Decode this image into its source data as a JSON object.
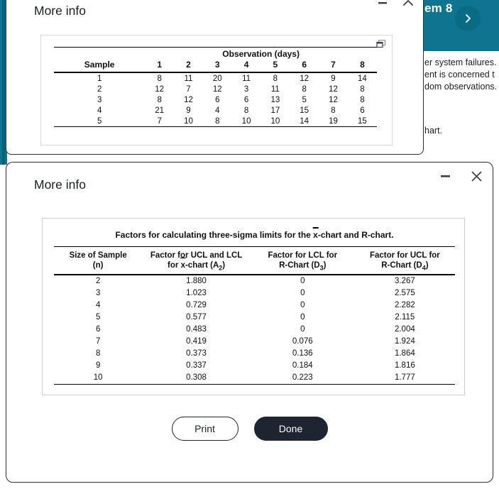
{
  "background": {
    "header": {
      "title": "em 8",
      "next_icon": "chevron-right-icon",
      "accent_color": "#0e7490",
      "button_color": "#0b6b85"
    },
    "body": {
      "line1": "er system failures.",
      "line2": "ent is concerned t",
      "line3": "dom observations.",
      "line4": "hart."
    }
  },
  "dialog_back": {
    "title": "More info",
    "window_controls": {
      "minimize": "minimize-icon",
      "maximize": "chevron-up-icon"
    },
    "popout_icon": "open-in-new-window-icon",
    "table": {
      "group_header": "Observation (days)",
      "row_header": "Sample",
      "columns": [
        "1",
        "2",
        "3",
        "4",
        "5",
        "6",
        "7",
        "8"
      ],
      "rows": [
        {
          "sample": "1",
          "values": [
            "8",
            "11",
            "20",
            "11",
            "8",
            "12",
            "9",
            "14"
          ]
        },
        {
          "sample": "2",
          "values": [
            "12",
            "7",
            "12",
            "3",
            "11",
            "8",
            "12",
            "8"
          ]
        },
        {
          "sample": "3",
          "values": [
            "8",
            "12",
            "6",
            "6",
            "13",
            "5",
            "12",
            "8"
          ]
        },
        {
          "sample": "4",
          "values": [
            "21",
            "9",
            "4",
            "8",
            "17",
            "15",
            "8",
            "6"
          ]
        },
        {
          "sample": "5",
          "values": [
            "7",
            "10",
            "8",
            "10",
            "10",
            "14",
            "19",
            "15"
          ]
        }
      ]
    }
  },
  "dialog_front": {
    "title": "More info",
    "window_controls": {
      "minimize": "minimize-icon",
      "close": "close-icon"
    },
    "table": {
      "caption_pre": "Factors for calculating three-sigma limits for the ",
      "caption_xbar": "x",
      "caption_post": "-chart and R-chart.",
      "columns": [
        {
          "line1": "Size of Sample",
          "line2": "(n)"
        },
        {
          "line1": "Factor for UCL and LCL",
          "line2_pre": "for ",
          "line2_xbar": "x",
          "line2_post": "-chart (A",
          "line2_sub": "2",
          "line2_end": ")"
        },
        {
          "line1": "Factor for LCL for",
          "line2_pre": "R-Chart (D",
          "line2_sub": "3",
          "line2_end": ")"
        },
        {
          "line1": "Factor for UCL for",
          "line2_pre": "R-Chart (D",
          "line2_sub": "4",
          "line2_end": ")"
        }
      ],
      "rows": [
        {
          "n": "2",
          "a2": "1.880",
          "d3": "0",
          "d4": "3.267"
        },
        {
          "n": "3",
          "a2": "1.023",
          "d3": "0",
          "d4": "2.575"
        },
        {
          "n": "4",
          "a2": "0.729",
          "d3": "0",
          "d4": "2.282"
        },
        {
          "n": "5",
          "a2": "0.577",
          "d3": "0",
          "d4": "2.115"
        },
        {
          "n": "6",
          "a2": "0.483",
          "d3": "0",
          "d4": "2.004"
        },
        {
          "n": "7",
          "a2": "0.419",
          "d3": "0.076",
          "d4": "1.924"
        },
        {
          "n": "8",
          "a2": "0.373",
          "d3": "0.136",
          "d4": "1.864"
        },
        {
          "n": "9",
          "a2": "0.337",
          "d3": "0.184",
          "d4": "1.816"
        },
        {
          "n": "10",
          "a2": "0.308",
          "d3": "0.223",
          "d4": "1.777"
        }
      ]
    },
    "actions": {
      "print_label": "Print",
      "done_label": "Done",
      "done_color": "#1e2430"
    }
  }
}
